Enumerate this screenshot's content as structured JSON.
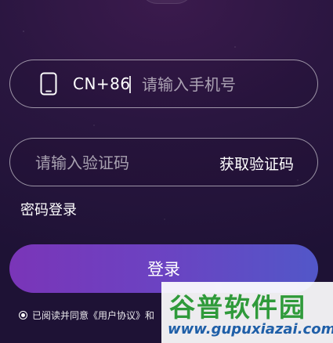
{
  "phone_field": {
    "country_code": "CN+86",
    "placeholder": "请输入手机号",
    "icon": "phone-icon"
  },
  "code_field": {
    "placeholder": "请输入验证码",
    "get_code_label": "获取验证码"
  },
  "password_login_label": "密码登录",
  "login_button_label": "登录",
  "agreement": {
    "prefix": "已阅读并同意",
    "user_agreement": "《用户协议》",
    "conjunction": "和"
  },
  "watermark": {
    "title": "谷普软件园",
    "url": "www.gupuxiazai.com"
  },
  "colors": {
    "background": "#2a1640",
    "button_start": "#7a35b8",
    "button_end": "#5257c8",
    "watermark_green": "#2f9a3a",
    "watermark_blue": "#1f5fa8"
  }
}
